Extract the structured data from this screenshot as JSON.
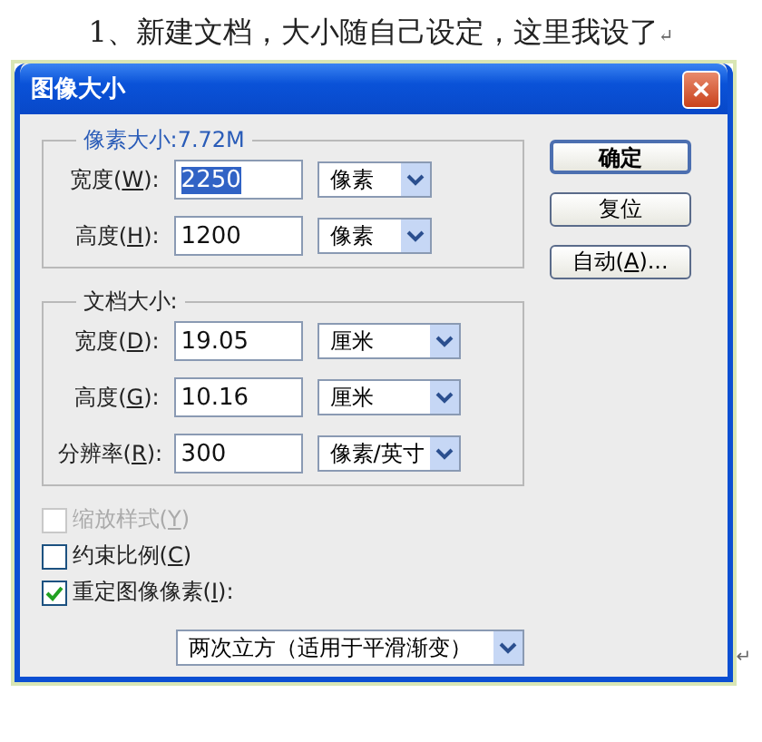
{
  "caption": {
    "text": "1、新建文档，大小随自己设定，这里我设了",
    "mark": "↵"
  },
  "dialog": {
    "title": "图像大小",
    "close": "✕"
  },
  "pixel_size": {
    "legend": "像素大小:7.72M",
    "rows": [
      {
        "before": "宽度(",
        "key": "W",
        "after": "):",
        "value": "2250",
        "highlighted": true,
        "unit": "像素"
      },
      {
        "before": "高度(",
        "key": "H",
        "after": "):",
        "value": "1200",
        "highlighted": false,
        "unit": "像素"
      }
    ]
  },
  "document_size": {
    "legend": "文档大小:",
    "rows": [
      {
        "before": "宽度(",
        "key": "D",
        "after": "):",
        "value": "19.05",
        "highlighted": false,
        "unit": "厘米"
      },
      {
        "before": "高度(",
        "key": "G",
        "after": "):",
        "value": "10.16",
        "highlighted": false,
        "unit": "厘米"
      },
      {
        "before": "分辨率(",
        "key": "R",
        "after": "):",
        "value": "300",
        "highlighted": false,
        "unit": "像素/英寸"
      }
    ]
  },
  "buttons": [
    {
      "label": "确定",
      "default": true
    },
    {
      "before": "复位",
      "default": false
    },
    {
      "before": "自动(",
      "key": "A",
      "after": ")...",
      "default": false
    }
  ],
  "checkboxes": [
    {
      "before": "缩放样式(",
      "key": "Y",
      "after": ")",
      "checked": false,
      "disabled": true
    },
    {
      "before": "约束比例(",
      "key": "C",
      "after": ")",
      "checked": false,
      "disabled": false
    },
    {
      "before": "重定图像像素(",
      "key": "I",
      "after": "):",
      "checked": true,
      "disabled": false
    }
  ],
  "resample": {
    "value": "两次立方（适用于平滑渐变）"
  },
  "end_mark": "↵"
}
